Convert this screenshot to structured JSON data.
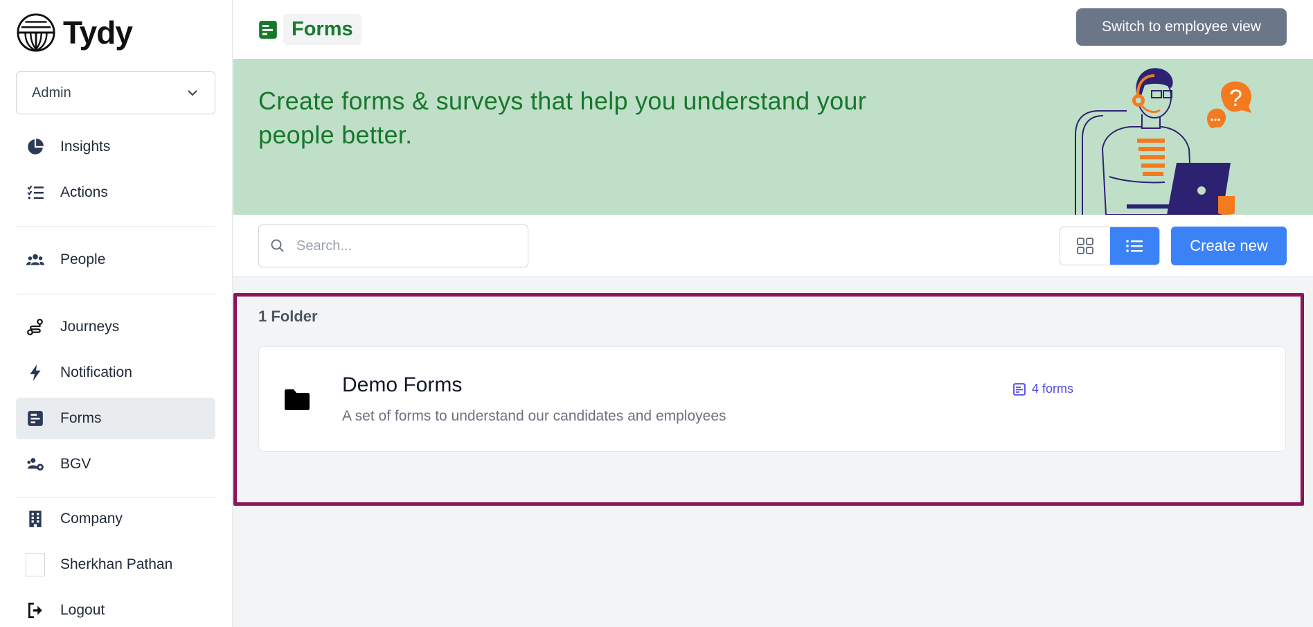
{
  "app": {
    "name": "Tydy"
  },
  "sidebar": {
    "role_selected": "Admin",
    "items": [
      {
        "label": "Insights",
        "icon": "pie-chart-icon"
      },
      {
        "label": "Actions",
        "icon": "checklist-icon"
      },
      {
        "label": "People",
        "icon": "people-icon"
      },
      {
        "label": "Journeys",
        "icon": "route-icon"
      },
      {
        "label": "Notification",
        "icon": "bolt-icon"
      },
      {
        "label": "Forms",
        "icon": "form-icon",
        "active": true
      },
      {
        "label": "BGV",
        "icon": "users-gear-icon"
      },
      {
        "label": "Company",
        "icon": "building-icon"
      },
      {
        "label": "Sherkhan Pathan",
        "icon": "avatar"
      },
      {
        "label": "Logout",
        "icon": "logout-icon"
      }
    ]
  },
  "header": {
    "title": "Forms",
    "switch_label": "Switch to employee view"
  },
  "banner": {
    "text": "Create forms & surveys that help you understand your people better."
  },
  "toolbar": {
    "search_placeholder": "Search...",
    "create_label": "Create new",
    "view_mode": "list"
  },
  "folders": {
    "count_label": "1 Folder",
    "items": [
      {
        "name": "Demo Forms",
        "description": "A set of forms to understand our candidates and employees",
        "forms_count": "4 forms"
      }
    ]
  },
  "colors": {
    "accent": "#3b82f6",
    "brand_green": "#17782b",
    "banner_bg": "#bfdfc8",
    "highlight_border": "#8c1458"
  }
}
